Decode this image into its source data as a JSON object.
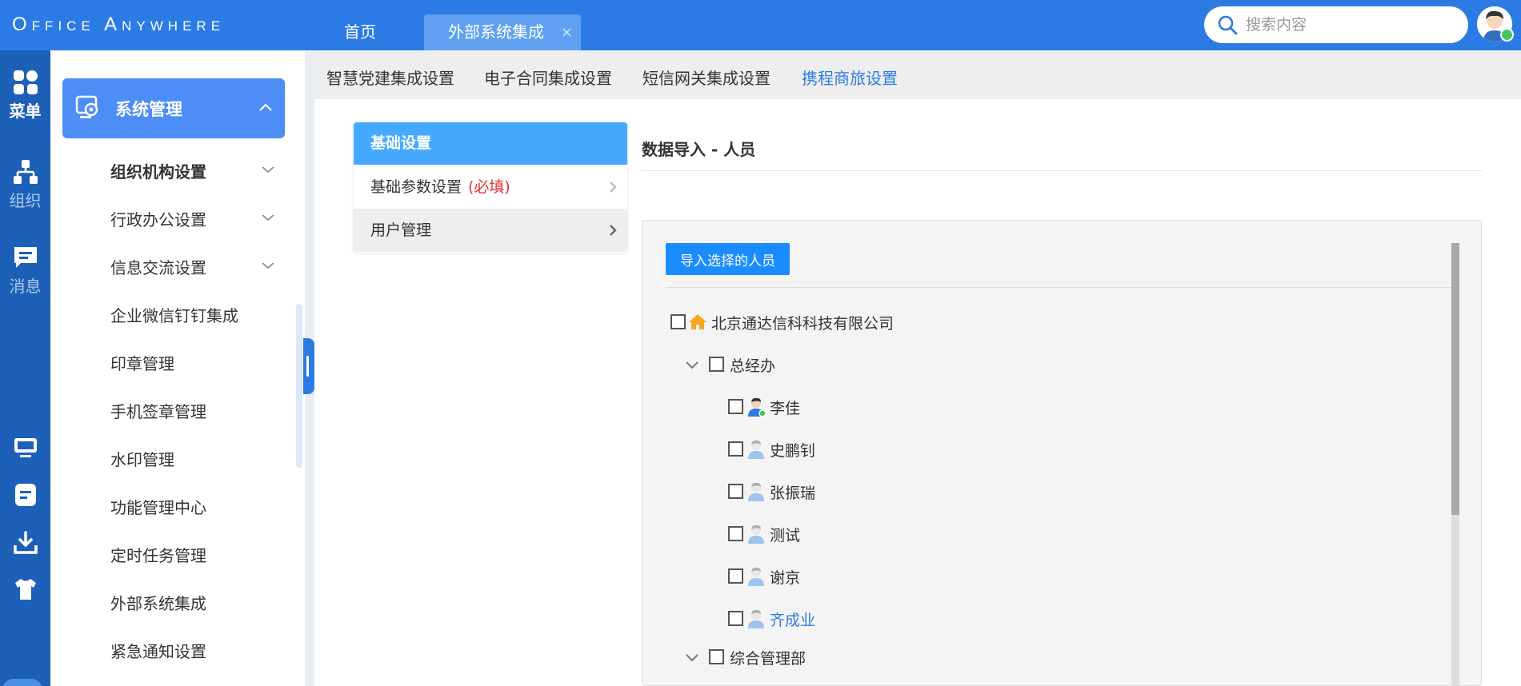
{
  "app": {
    "logo_main": "Office Anywhere",
    "logo_reg": "®"
  },
  "tabs": {
    "home": "首页",
    "active": "外部系统集成",
    "close_glyph": "×"
  },
  "search": {
    "placeholder": "搜索内容"
  },
  "rail": {
    "menu": "菜单",
    "org": "组织",
    "msg": "消息"
  },
  "sidebar": {
    "section": "系统管理",
    "items": [
      {
        "label": "组织机构设置",
        "expandable": true
      },
      {
        "label": "行政办公设置",
        "expandable": true
      },
      {
        "label": "信息交流设置",
        "expandable": true
      },
      {
        "label": "企业微信钉钉集成"
      },
      {
        "label": "印章管理"
      },
      {
        "label": "手机签章管理"
      },
      {
        "label": "水印管理"
      },
      {
        "label": "功能管理中心"
      },
      {
        "label": "定时任务管理"
      },
      {
        "label": "外部系统集成"
      },
      {
        "label": "紧急通知设置"
      }
    ]
  },
  "subnav": {
    "items": [
      "智慧党建集成设置",
      "电子合同集成设置",
      "短信网关集成设置",
      "携程商旅设置"
    ],
    "active": "携程商旅设置"
  },
  "panel": {
    "header": "基础设置",
    "rows": [
      {
        "label": "基础参数设置",
        "note": "(必填)"
      },
      {
        "label": "用户管理"
      }
    ]
  },
  "content": {
    "title": "数据导入 - 人员",
    "import_button": "导入选择的人员"
  },
  "tree": {
    "root": "北京通达信科科技有限公司",
    "groups": [
      {
        "name": "总经办",
        "members": [
          "李佳",
          "史鹏钊",
          "张振瑞",
          "测试",
          "谢京",
          "齐成业"
        ]
      },
      {
        "name": "综合管理部"
      }
    ],
    "highlighted_member": "齐成业"
  },
  "colors": {
    "primary": "#2c7be5",
    "rail": "#1d60b7",
    "panel_header": "#45a9ff",
    "required": "#e62e2e",
    "online": "#3ec95a"
  }
}
